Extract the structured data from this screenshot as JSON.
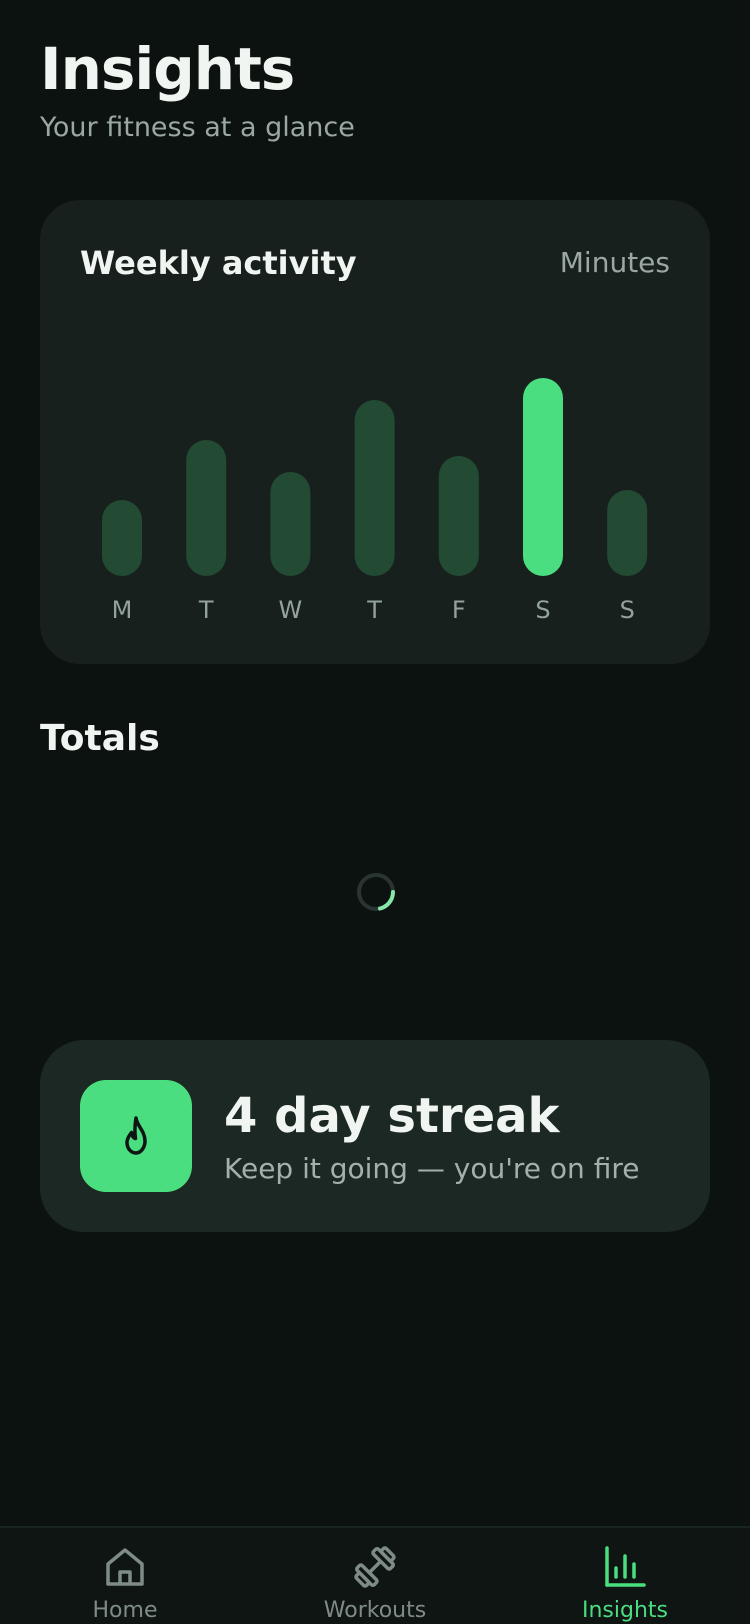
{
  "header": {
    "title": "Insights",
    "subtitle": "Your fitness at a glance"
  },
  "activity_card": {
    "title": "Weekly activity",
    "unit": "Minutes"
  },
  "chart_data": {
    "type": "bar",
    "title": "Weekly activity",
    "ylabel": "Minutes",
    "categories": [
      "M",
      "T",
      "W",
      "T",
      "F",
      "S",
      "S"
    ],
    "values": [
      38,
      68,
      52,
      88,
      60,
      99,
      43
    ],
    "highlight_index": 5,
    "ylim": [
      0,
      100
    ],
    "grid": false,
    "colors": {
      "bar": "#234a33",
      "highlight": "#4ade80"
    }
  },
  "totals": {
    "title": "Totals"
  },
  "streak": {
    "title": "4 day streak",
    "subtitle": "Keep it going — you're on fire",
    "icon": "flame-icon"
  },
  "tab_bar": {
    "tabs": [
      {
        "label": "Home",
        "icon": "home-icon",
        "active": false
      },
      {
        "label": "Workouts",
        "icon": "dumbbell-icon",
        "active": false
      },
      {
        "label": "Insights",
        "icon": "bar-chart-icon",
        "active": true
      }
    ]
  },
  "colors": {
    "background": "#0c1210",
    "card": "#17201d",
    "accent": "#4ade80",
    "muted_text": "#9aa8a1"
  }
}
